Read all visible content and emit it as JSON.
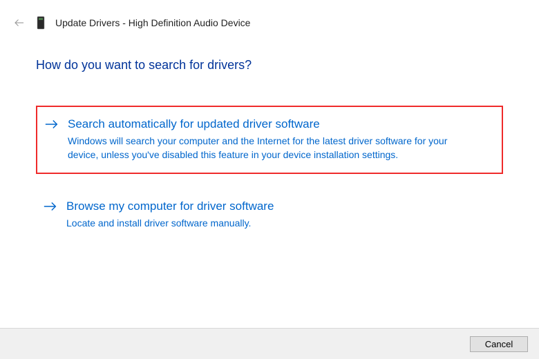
{
  "header": {
    "title": "Update Drivers - High Definition Audio Device"
  },
  "content": {
    "question": "How do you want to search for drivers?",
    "options": [
      {
        "title": "Search automatically for updated driver software",
        "description": "Windows will search your computer and the Internet for the latest driver software for your device, unless you've disabled this feature in your device installation settings.",
        "highlighted": true
      },
      {
        "title": "Browse my computer for driver software",
        "description": "Locate and install driver software manually.",
        "highlighted": false
      }
    ]
  },
  "footer": {
    "cancel_label": "Cancel"
  }
}
